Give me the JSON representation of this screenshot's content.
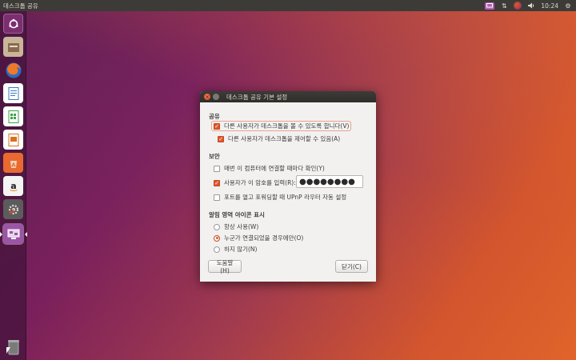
{
  "top_panel": {
    "title": "데스크톱 공유",
    "volume_icon": "volume-icon",
    "clock": "10:24",
    "icons": [
      "sharing-icon",
      "network-icon",
      "keyboard-icon",
      "volume-icon",
      "settings-icon"
    ]
  },
  "launcher": {
    "items": [
      {
        "name": "dash-icon",
        "color": "#8a3d78"
      },
      {
        "name": "files-icon",
        "color": "#8a6a4e"
      },
      {
        "name": "firefox-icon",
        "color": "#e8762c"
      },
      {
        "name": "writer-icon",
        "color": "#3b7ac4"
      },
      {
        "name": "calc-icon",
        "color": "#3fa14b"
      },
      {
        "name": "impress-icon",
        "color": "#d9701e"
      },
      {
        "name": "software-center-icon",
        "color": "#e86a30"
      },
      {
        "name": "amazon-icon",
        "color": "#e0e0e0"
      },
      {
        "name": "system-settings-icon",
        "color": "#6a6a6a"
      },
      {
        "name": "desktop-sharing-icon",
        "color": "#9c55a6"
      },
      {
        "name": "trash-icon",
        "color": "#555555"
      }
    ]
  },
  "dialog": {
    "title": "데스크톱 공유 기본 설정",
    "sharing": {
      "heading": "공유",
      "allow_view": "다른 사용자가 데스크톱을 볼 수 있도록 합니다(V)",
      "allow_control": "다른 사용자가 데스크톱을 제어할 수 있음(A)"
    },
    "security": {
      "heading": "보안",
      "confirm_each": "매번 이 컴퓨터에 연결할 때마다 확인(Y)",
      "require_password": "사용자가 이 암호를 입력(R):",
      "password_value": "●●●●●●●●",
      "upnp": "포트를 열고 포워딩할 때 UPnP 라우터 자동 설정"
    },
    "notification": {
      "heading": "알림 영역 아이콘 표시",
      "always": "항상 사용(W)",
      "when_connected": "누군가 연결되었을 경우에만(O)",
      "never": "하지 않기(N)"
    },
    "help_button": "도움말(H)",
    "close_button": "닫기(C)"
  },
  "colors": {
    "accent": "#e0572b",
    "panel": "#3c3b37"
  }
}
